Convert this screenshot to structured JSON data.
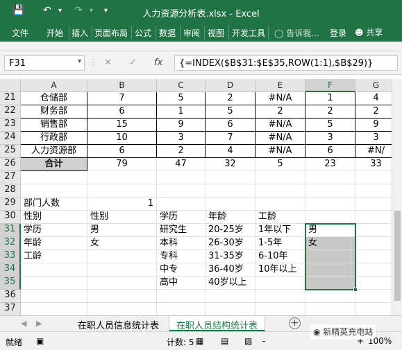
{
  "window": {
    "title": "人力资源分析表.xlsx - Excel",
    "ribbon_color": "#217346"
  },
  "ribbon": {
    "tabs": [
      "文件",
      "开始",
      "插入",
      "页面布局",
      "公式",
      "数据",
      "审阅",
      "视图",
      "开发工具"
    ],
    "tell_me": "告诉我...",
    "login": "登录",
    "share": "共享"
  },
  "formula_bar": {
    "name_box": "F31",
    "cancel": "✕",
    "enter": "✓",
    "fx": "fx",
    "formula": "{=INDEX($B$31:$E$35,ROW(1:1),$B$29)}"
  },
  "columns": [
    "A",
    "B",
    "C",
    "D",
    "E",
    "F",
    "G"
  ],
  "rows": {
    "r21": {
      "num": "21",
      "A": "仓储部",
      "B": "7",
      "C": "5",
      "D": "2",
      "E": "#N/A",
      "F": "1",
      "G": "4"
    },
    "r22": {
      "num": "22",
      "A": "财务部",
      "B": "6",
      "C": "1",
      "D": "5",
      "E": "2",
      "F": "2",
      "G": "2"
    },
    "r23": {
      "num": "23",
      "A": "销售部",
      "B": "15",
      "C": "9",
      "D": "6",
      "E": "#N/A",
      "F": "5",
      "G": "9"
    },
    "r24": {
      "num": "24",
      "A": "行政部",
      "B": "10",
      "C": "3",
      "D": "7",
      "E": "#N/A",
      "F": "3",
      "G": "3"
    },
    "r25": {
      "num": "25",
      "A": "人力资源部",
      "B": "6",
      "C": "2",
      "D": "4",
      "E": "#N/A",
      "F": "6",
      "G": "#N/"
    },
    "r26": {
      "num": "26",
      "A": "合计",
      "B": "79",
      "C": "47",
      "D": "32",
      "E": "5",
      "F": "23",
      "G": "33"
    },
    "r27": {
      "num": "27"
    },
    "r28": {
      "num": "28"
    },
    "r29": {
      "num": "29",
      "A": "部门人数",
      "B": "1"
    },
    "r30": {
      "num": "30",
      "A": "性别",
      "B": "性别",
      "C": "学历",
      "D": "年龄",
      "E": "工龄"
    },
    "r31": {
      "num": "31",
      "A": "学历",
      "B": "男",
      "C": "研究生",
      "D": "20-25岁",
      "E": "1年以下",
      "F": "男"
    },
    "r32": {
      "num": "32",
      "A": "年龄",
      "B": "女",
      "C": "本科",
      "D": "26-30岁",
      "E": "1-5年",
      "F": "女"
    },
    "r33": {
      "num": "33",
      "A": "工龄",
      "C": "专科",
      "D": "31-35岁",
      "E": "6-10年"
    },
    "r34": {
      "num": "34",
      "C": "中专",
      "D": "36-40岁",
      "E": "10年以上"
    },
    "r35": {
      "num": "35",
      "C": "高中",
      "D": "40岁以上"
    },
    "r36": {
      "num": "36"
    },
    "r37": {
      "num": "37"
    },
    "r38": {
      "num": "38"
    }
  },
  "sheets": {
    "tab1": "在职人员信息统计表",
    "tab2": "在职人员结构统计表",
    "add": "+"
  },
  "status": {
    "ready": "就绪",
    "count": "计数: 5",
    "zoom_minus": "-",
    "zoom_plus": "+",
    "zoom": "100%"
  },
  "watermark": "新精英充电站"
}
